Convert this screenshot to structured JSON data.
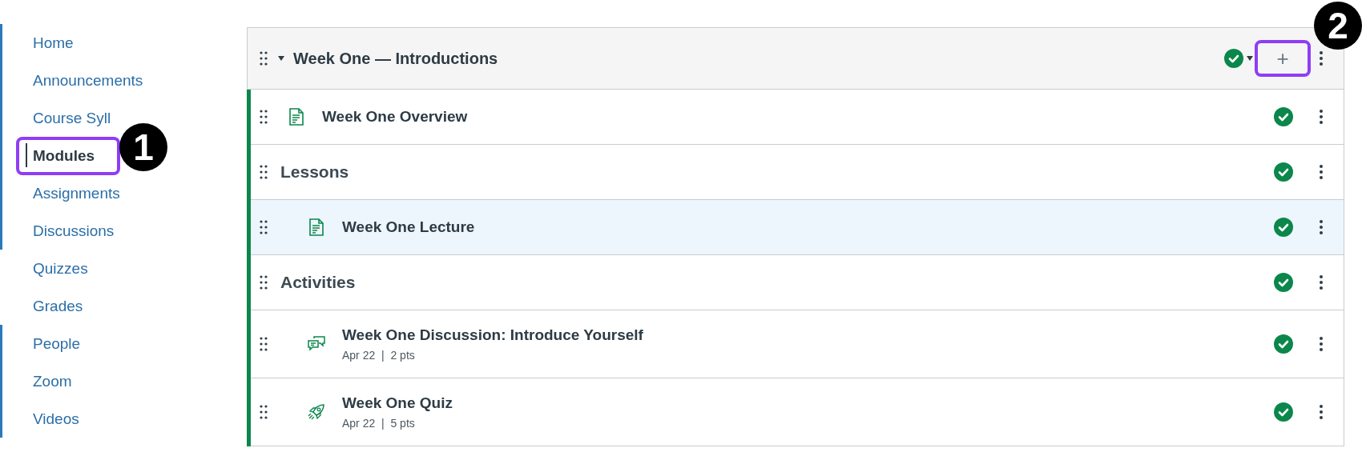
{
  "sidebar": {
    "items": [
      {
        "label": "Home",
        "selected": false,
        "bar": true
      },
      {
        "label": "Announcements",
        "selected": false,
        "bar": true
      },
      {
        "label": "Course Syll",
        "selected": false,
        "bar": true
      },
      {
        "label": "Modules",
        "selected": true,
        "bar": true,
        "highlighted": true,
        "badge": "1"
      },
      {
        "label": "Assignments",
        "selected": false,
        "bar": true
      },
      {
        "label": "Discussions",
        "selected": false,
        "bar": true
      },
      {
        "label": "Quizzes",
        "selected": false,
        "bar": false
      },
      {
        "label": "Grades",
        "selected": false,
        "bar": false
      },
      {
        "label": "People",
        "selected": false,
        "bar": true
      },
      {
        "label": "Zoom",
        "selected": false,
        "bar": true
      },
      {
        "label": "Videos",
        "selected": false,
        "bar": true
      }
    ]
  },
  "module": {
    "title": "Week One — Introductions",
    "expanded": true,
    "published": true,
    "add_button": {
      "label": "+",
      "highlighted": true,
      "badge": "2"
    },
    "items": [
      {
        "kind": "page",
        "title": "Week One Overview",
        "published": true,
        "highlighted": false
      },
      {
        "kind": "subheader",
        "title": "Lessons",
        "published": true,
        "highlighted": false,
        "children": [
          {
            "kind": "page",
            "title": "Week One Lecture",
            "published": true,
            "highlighted": true
          }
        ]
      },
      {
        "kind": "subheader",
        "title": "Activities",
        "published": true,
        "highlighted": false,
        "children": [
          {
            "kind": "discussion",
            "title": "Week One Discussion: Introduce Yourself",
            "meta": "Apr 22  |  2 pts",
            "published": true,
            "highlighted": false
          },
          {
            "kind": "quiz",
            "title": "Week One Quiz",
            "meta": "Apr 22  |  5 pts",
            "published": true,
            "highlighted": false
          }
        ]
      }
    ]
  }
}
